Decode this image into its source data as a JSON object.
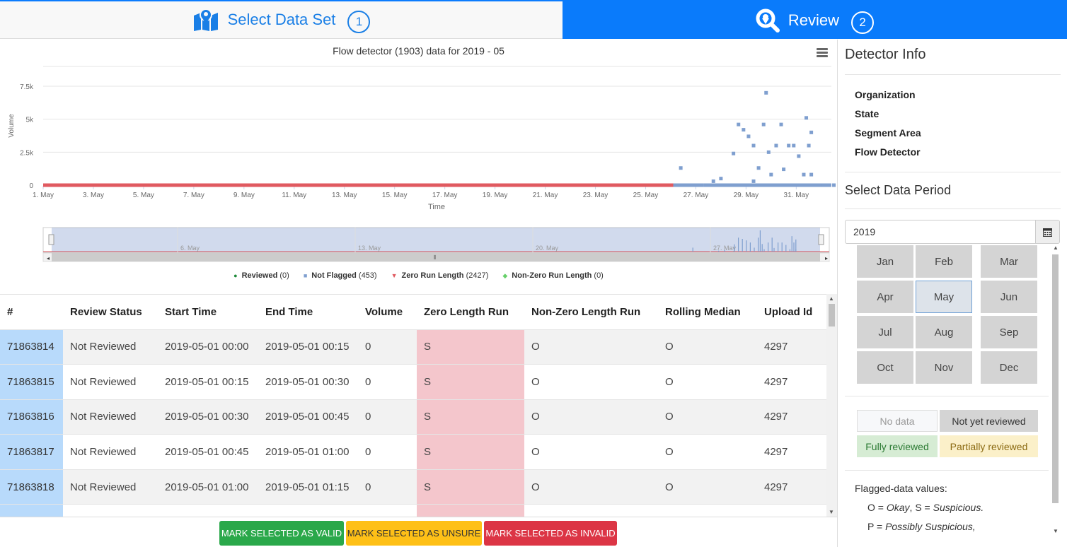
{
  "tabs": {
    "select": {
      "label": "Select Data Set",
      "num": "1"
    },
    "review": {
      "label": "Review",
      "num": "2"
    }
  },
  "chart_data": {
    "type": "scatter",
    "title": "Flow detector (1903) data for 2019 - 05",
    "xlabel": "Time",
    "ylabel": "Volume",
    "x_ticks": [
      "1. May",
      "3. May",
      "5. May",
      "7. May",
      "9. May",
      "11. May",
      "13. May",
      "15. May",
      "17. May",
      "19. May",
      "21. May",
      "23. May",
      "25. May",
      "27. May",
      "29. May",
      "31. May"
    ],
    "y_ticks": [
      "0",
      "2.5k",
      "5k",
      "7.5k"
    ],
    "ylim": [
      0,
      9000
    ],
    "navigator_ticks": [
      "6. May",
      "13. May",
      "20. May",
      "27. May"
    ],
    "legend": [
      {
        "name": "Reviewed",
        "count": "(0)",
        "color": "#1e8a3a",
        "symbol": "●"
      },
      {
        "name": "Not Flagged",
        "count": "(453)",
        "color": "#7f9fcf",
        "symbol": "■"
      },
      {
        "name": "Zero Run Length",
        "count": "(2427)",
        "color": "#e05a60",
        "symbol": "▼"
      },
      {
        "name": "Non-Zero Run Length",
        "count": "(0)",
        "color": "#66d06a",
        "symbol": "◆"
      }
    ],
    "series": [
      {
        "name": "Zero Run Length",
        "color": "#e05a60",
        "x_range": [
          "1. May",
          "31. May"
        ],
        "y": 0
      },
      {
        "name": "Not Flagged",
        "color": "#7f9fcf",
        "points": [
          {
            "x": 26.4,
            "y": 1300
          },
          {
            "x": 27.7,
            "y": 300
          },
          {
            "x": 28.0,
            "y": 500
          },
          {
            "x": 28.5,
            "y": 2400
          },
          {
            "x": 28.7,
            "y": 4600
          },
          {
            "x": 28.9,
            "y": 4200
          },
          {
            "x": 29.1,
            "y": 3700
          },
          {
            "x": 29.3,
            "y": 3000
          },
          {
            "x": 29.3,
            "y": 300
          },
          {
            "x": 29.5,
            "y": 1300
          },
          {
            "x": 29.7,
            "y": 4600
          },
          {
            "x": 29.8,
            "y": 7000
          },
          {
            "x": 29.9,
            "y": 2500
          },
          {
            "x": 30.0,
            "y": 800
          },
          {
            "x": 30.2,
            "y": 3000
          },
          {
            "x": 30.4,
            "y": 4600
          },
          {
            "x": 30.5,
            "y": 1200
          },
          {
            "x": 30.7,
            "y": 3000
          },
          {
            "x": 30.9,
            "y": 3000
          },
          {
            "x": 31.1,
            "y": 2200
          },
          {
            "x": 31.3,
            "y": 800
          },
          {
            "x": 31.4,
            "y": 5100
          },
          {
            "x": 31.5,
            "y": 3000
          },
          {
            "x": 31.6,
            "y": 4000
          },
          {
            "x": 31.6,
            "y": 800
          },
          {
            "x": 32.1,
            "y": 0
          },
          {
            "x": 32.5,
            "y": 0
          }
        ]
      }
    ]
  },
  "table": {
    "headers": [
      "#",
      "Review Status",
      "Start Time",
      "End Time",
      "Volume",
      "Zero Length Run",
      "Non-Zero Length Run",
      "Rolling Median",
      "Upload Id"
    ],
    "rows": [
      [
        "71863814",
        "Not Reviewed",
        "2019-05-01 00:00",
        "2019-05-01 00:15",
        "0",
        "S",
        "O",
        "O",
        "4297"
      ],
      [
        "71863815",
        "Not Reviewed",
        "2019-05-01 00:15",
        "2019-05-01 00:30",
        "0",
        "S",
        "O",
        "O",
        "4297"
      ],
      [
        "71863816",
        "Not Reviewed",
        "2019-05-01 00:30",
        "2019-05-01 00:45",
        "0",
        "S",
        "O",
        "O",
        "4297"
      ],
      [
        "71863817",
        "Not Reviewed",
        "2019-05-01 00:45",
        "2019-05-01 01:00",
        "0",
        "S",
        "O",
        "O",
        "4297"
      ],
      [
        "71863818",
        "Not Reviewed",
        "2019-05-01 01:00",
        "2019-05-01 01:15",
        "0",
        "S",
        "O",
        "O",
        "4297"
      ]
    ]
  },
  "buttons": {
    "valid": "MARK SELECTED AS VALID",
    "unsure": "MARK SELECTED AS UNSURE",
    "invalid": "MARK SELECTED AS INVALID"
  },
  "panel": {
    "detector_title": "Detector Info",
    "info_labels": [
      "Organization",
      "State",
      "Segment Area",
      "Flow Detector"
    ],
    "period_title": "Select Data Period",
    "year": "2019",
    "months": [
      "Jan",
      "Feb",
      "Mar",
      "Apr",
      "May",
      "Jun",
      "Jul",
      "Aug",
      "Sep",
      "Oct",
      "Nov",
      "Dec"
    ],
    "selected_month": "May",
    "key": {
      "no_data": "No data",
      "not_yet": "Not yet reviewed",
      "fully": "Fully reviewed",
      "partially": "Partially reviewed"
    },
    "notes": {
      "title": "Flagged-data values:",
      "o_code": "O",
      "o_text": "Okay",
      "s_code": "S",
      "s_text": "Suspicious.",
      "p_code": "P",
      "p_text": "Possibly Suspicious,"
    }
  }
}
